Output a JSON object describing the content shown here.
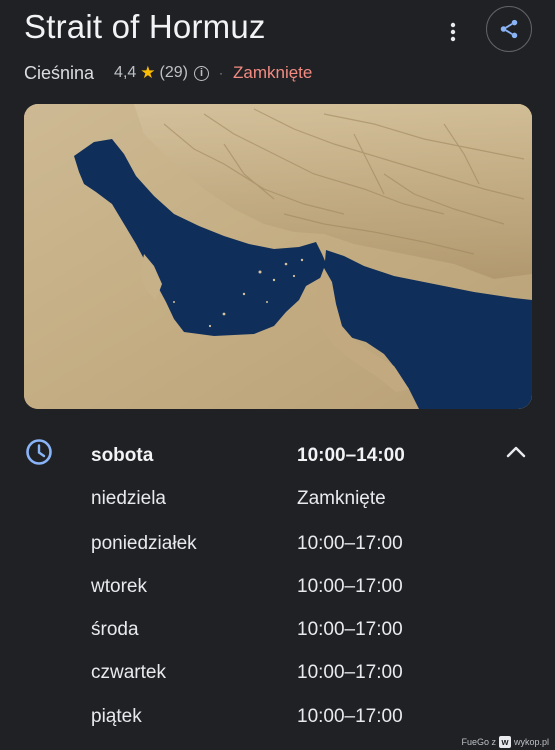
{
  "header": {
    "title": "Strait of Hormuz",
    "category": "Cieśnina",
    "rating": "4,4",
    "reviews_count": "(29)",
    "status": "Zamknięte",
    "more_icon": "more-vert-icon",
    "share_icon": "share-icon"
  },
  "map": {
    "image_icon": "terrain-map"
  },
  "hours": {
    "icon": "clock-icon",
    "collapse_icon": "chevron-up-icon",
    "rows": [
      {
        "day": "sobota",
        "time": "10:00–14:00"
      },
      {
        "day": "niedziela",
        "time": "Zamknięte"
      },
      {
        "day": "poniedziałek",
        "time": "10:00–17:00"
      },
      {
        "day": "wtorek",
        "time": "10:00–17:00"
      },
      {
        "day": "środa",
        "time": "10:00–17:00"
      },
      {
        "day": "czwartek",
        "time": "10:00–17:00"
      },
      {
        "day": "piątek",
        "time": "10:00–17:00"
      }
    ]
  },
  "footer": {
    "prefix": "FueGo z",
    "site": "wykop.pl"
  },
  "colors": {
    "background": "#202124",
    "status_closed": "#f28b82",
    "star": "#fbbc04",
    "clock": "#8ab4f8",
    "sea": "#0f2f5a",
    "land": "#c9b48d"
  }
}
